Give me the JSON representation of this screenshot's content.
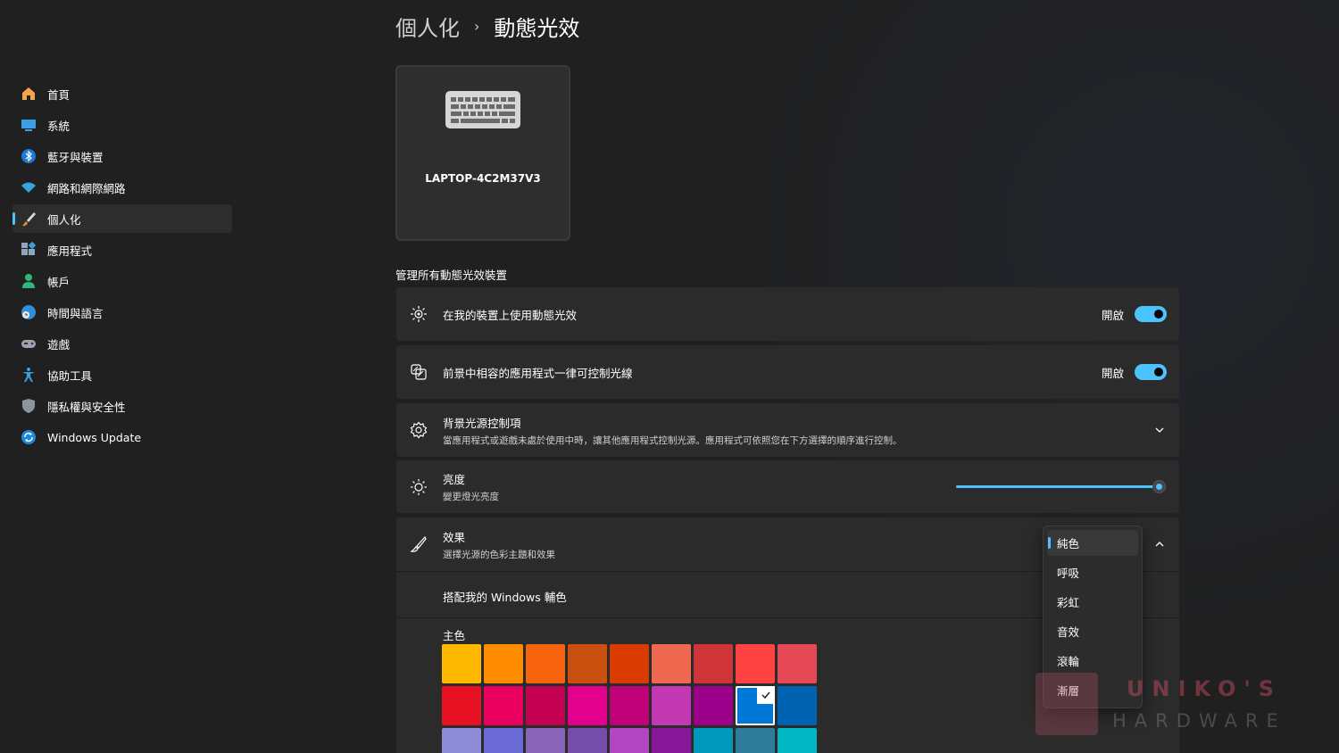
{
  "sidebar": {
    "items": [
      {
        "label": "首頁",
        "icon": "home-icon"
      },
      {
        "label": "系統",
        "icon": "monitor-icon"
      },
      {
        "label": "藍牙與裝置",
        "icon": "bluetooth-icon"
      },
      {
        "label": "網路和網際網路",
        "icon": "wifi-icon"
      },
      {
        "label": "個人化",
        "icon": "brush-icon",
        "active": true
      },
      {
        "label": "應用程式",
        "icon": "apps-icon"
      },
      {
        "label": "帳戶",
        "icon": "person-icon"
      },
      {
        "label": "時間與語言",
        "icon": "globe-clock-icon"
      },
      {
        "label": "遊戲",
        "icon": "gamepad-icon"
      },
      {
        "label": "協助工具",
        "icon": "accessibility-icon"
      },
      {
        "label": "隱私權與安全性",
        "icon": "shield-icon"
      },
      {
        "label": "Windows Update",
        "icon": "update-icon"
      }
    ]
  },
  "header": {
    "parent": "個人化",
    "separator": "›",
    "title": "動態光效"
  },
  "device": {
    "name": "LAPTOP-4C2M37V3",
    "icon": "keyboard-icon"
  },
  "section_title": "管理所有動態光效裝置",
  "settings": {
    "use_lighting": {
      "title": "在我的裝置上使用動態光效",
      "state_label": "開啟",
      "on": true
    },
    "foreground_apps": {
      "title": "前景中相容的應用程式一律可控制光線",
      "state_label": "開啟",
      "on": true
    },
    "background_control": {
      "title": "背景光源控制項",
      "desc": "當應用程式或遊戲未處於使用中時，讓其他應用程式控制光源。應用程式可依照您在下方選擇的順序進行控制。"
    },
    "brightness": {
      "title": "亮度",
      "desc": "變更燈光亮度",
      "value_percent": 97
    },
    "effects": {
      "title": "效果",
      "desc": "選擇光源的色彩主題和效果"
    },
    "match_accent": {
      "label": "搭配我的 Windows 輔色"
    },
    "main_color": {
      "label": "主色"
    }
  },
  "dropdown": {
    "selected": "純色",
    "options": [
      "純色",
      "呼吸",
      "彩虹",
      "音效",
      "滾輪",
      "漸層"
    ]
  },
  "swatches": [
    "#ffb900",
    "#ff8c00",
    "#f7630c",
    "#ca5010",
    "#da3b01",
    "#ef6950",
    "#d13438",
    "#ff4343",
    "#e74856",
    "#e81123",
    "#ea005e",
    "#c30052",
    "#e3008c",
    "#bf0077",
    "#c239b3",
    "#9a0089",
    "#0078d7",
    "#0063b1",
    "#8e8cd8",
    "#6b69d6",
    "#8764b8",
    "#744da9",
    "#b146c2",
    "#881798",
    "#0099bc",
    "#2d7d9a",
    "#00b7c3"
  ],
  "selected_swatch_index": 16,
  "watermark": {
    "title": "UNIKO'S",
    "subtitle": "HARDWARE"
  },
  "colors": {
    "accent": "#4cc2ff",
    "background": "#202020",
    "card": "#2b2b2b"
  }
}
